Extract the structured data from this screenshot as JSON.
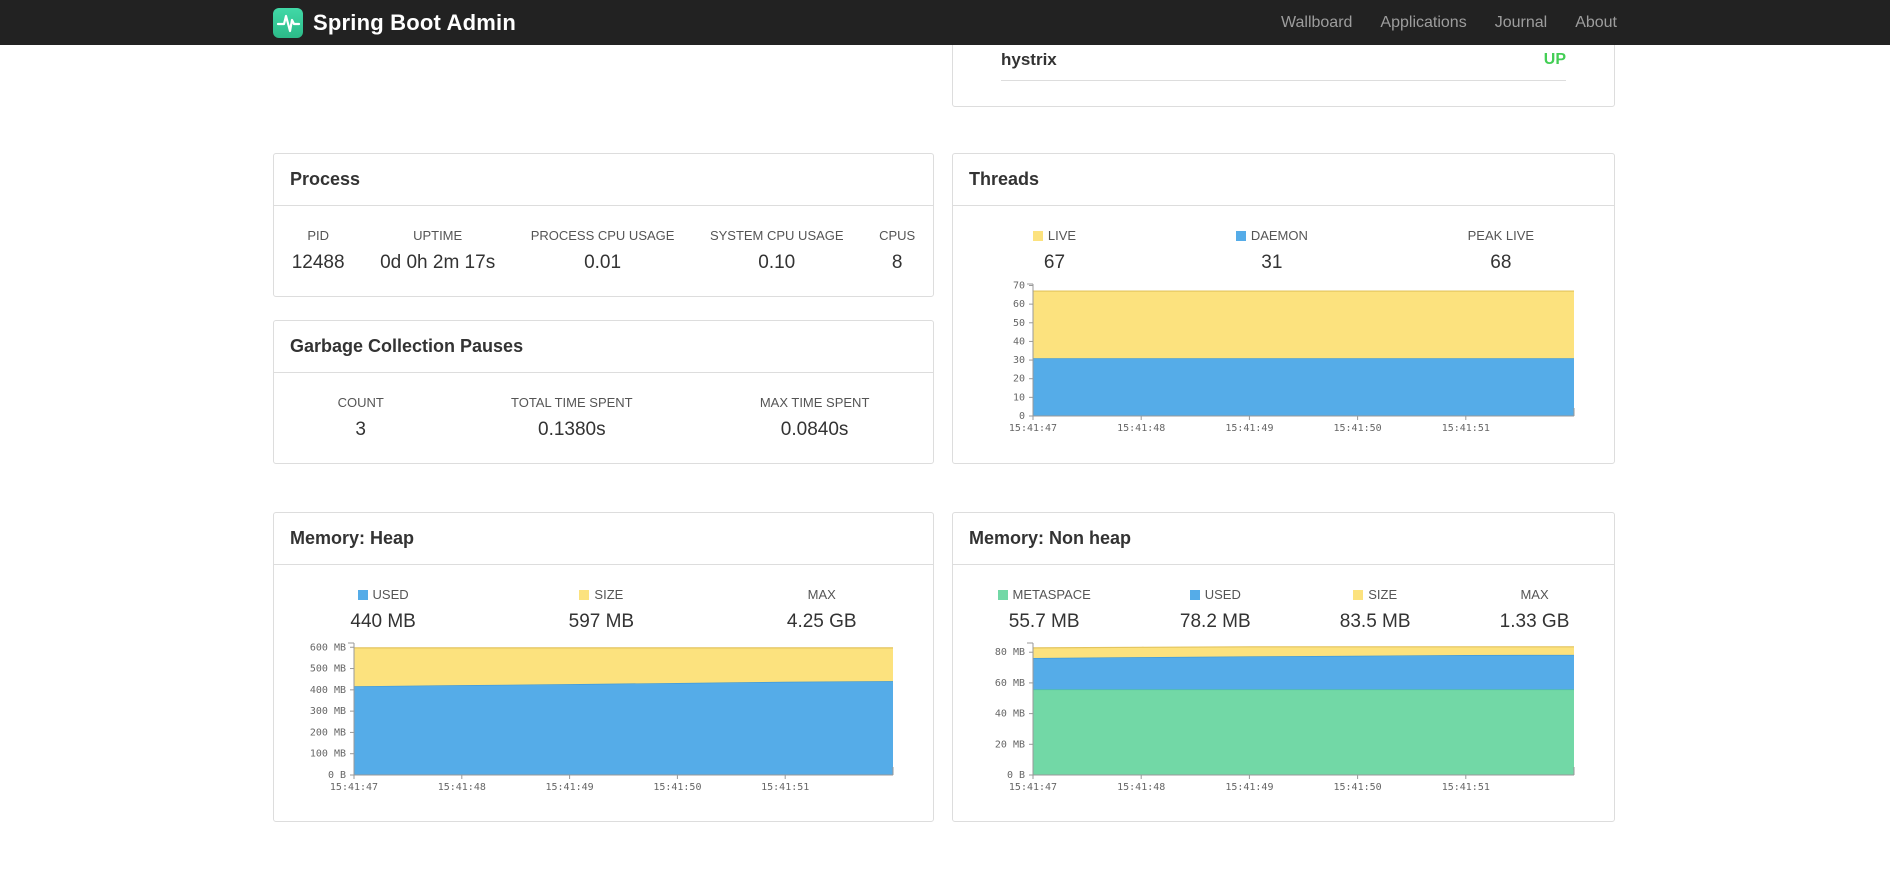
{
  "navbar": {
    "brand": "Spring Boot Admin",
    "links": [
      {
        "label": "Wallboard"
      },
      {
        "label": "Applications"
      },
      {
        "label": "Journal"
      },
      {
        "label": "About"
      }
    ],
    "brand_color": "#35CF9E"
  },
  "health_panel": {
    "item": "hystrix",
    "status": "UP",
    "status_color": "#43CE55"
  },
  "process": {
    "title": "Process",
    "stats": [
      {
        "label": "PID",
        "value": "12488"
      },
      {
        "label": "UPTIME",
        "value": "0d 0h 2m 17s"
      },
      {
        "label": "PROCESS CPU USAGE",
        "value": "0.01"
      },
      {
        "label": "SYSTEM CPU USAGE",
        "value": "0.10"
      },
      {
        "label": "CPUS",
        "value": "8"
      }
    ]
  },
  "gc": {
    "title": "Garbage Collection Pauses",
    "stats": [
      {
        "label": "COUNT",
        "value": "3"
      },
      {
        "label": "TOTAL TIME SPENT",
        "value": "0.1380s"
      },
      {
        "label": "MAX TIME SPENT",
        "value": "0.0840s"
      }
    ]
  },
  "threads": {
    "title": "Threads",
    "legend": [
      {
        "label": "LIVE",
        "value": "67",
        "color": "#FCE27E"
      },
      {
        "label": "DAEMON",
        "value": "31",
        "color": "#55ACE8"
      },
      {
        "label": "PEAK LIVE",
        "value": "68"
      }
    ]
  },
  "heap": {
    "title": "Memory: Heap",
    "legend": [
      {
        "label": "USED",
        "value": "440 MB",
        "color": "#55ACE8"
      },
      {
        "label": "SIZE",
        "value": "597 MB",
        "color": "#FCE27E"
      },
      {
        "label": "MAX",
        "value": "4.25 GB"
      }
    ]
  },
  "nonheap": {
    "title": "Memory: Non heap",
    "legend": [
      {
        "label": "METASPACE",
        "value": "55.7 MB",
        "color": "#72D8A6"
      },
      {
        "label": "USED",
        "value": "78.2 MB",
        "color": "#55ACE8"
      },
      {
        "label": "SIZE",
        "value": "83.5 MB",
        "color": "#FCE27E"
      },
      {
        "label": "MAX",
        "value": "1.33 GB"
      }
    ]
  },
  "chart_data": [
    {
      "id": "threads",
      "type": "area",
      "title": "Threads",
      "x_ticks": [
        "15:41:47",
        "15:41:48",
        "15:41:49",
        "15:41:50",
        "15:41:51"
      ],
      "y_max": 70.8,
      "y_ticks": [
        {
          "v": 0,
          "label": "0"
        },
        {
          "v": 10,
          "label": "10"
        },
        {
          "v": 20,
          "label": "20"
        },
        {
          "v": 30,
          "label": "30"
        },
        {
          "v": 40,
          "label": "40"
        },
        {
          "v": 50,
          "label": "50"
        },
        {
          "v": 60,
          "label": "60"
        },
        {
          "v": 70,
          "label": "70"
        }
      ],
      "series": [
        {
          "name": "DAEMON",
          "color": "#55ACE8",
          "line": "#3D96D4",
          "values": [
            31,
            31,
            31,
            31,
            31,
            31
          ]
        },
        {
          "name": "LIVE",
          "color": "#FCE27E",
          "line": "#E3C45C",
          "values": [
            67,
            67,
            67,
            67,
            67,
            67
          ]
        }
      ]
    },
    {
      "id": "heap",
      "type": "area",
      "title": "Memory: Heap",
      "x_ticks": [
        "15:41:47",
        "15:41:48",
        "15:41:49",
        "15:41:50",
        "15:41:51"
      ],
      "y_max": 620,
      "y_ticks": [
        {
          "v": 0,
          "label": "0 B"
        },
        {
          "v": 100,
          "label": "100 MB"
        },
        {
          "v": 200,
          "label": "200 MB"
        },
        {
          "v": 300,
          "label": "300 MB"
        },
        {
          "v": 400,
          "label": "400 MB"
        },
        {
          "v": 500,
          "label": "500 MB"
        },
        {
          "v": 600,
          "label": "600 MB"
        }
      ],
      "series": [
        {
          "name": "USED",
          "color": "#55ACE8",
          "line": "#3D96D4",
          "values": [
            417,
            422,
            427,
            432,
            438,
            441
          ]
        },
        {
          "name": "SIZE",
          "color": "#FCE27E",
          "line": "#E3C45C",
          "values": [
            597,
            597,
            597,
            597,
            597,
            597
          ]
        }
      ]
    },
    {
      "id": "nonheap",
      "type": "area",
      "title": "Memory: Non heap",
      "x_ticks": [
        "15:41:47",
        "15:41:48",
        "15:41:49",
        "15:41:50",
        "15:41:51"
      ],
      "y_max": 86,
      "y_ticks": [
        {
          "v": 0,
          "label": "0 B"
        },
        {
          "v": 20,
          "label": "20 MB"
        },
        {
          "v": 40,
          "label": "40 MB"
        },
        {
          "v": 60,
          "label": "60 MB"
        },
        {
          "v": 80,
          "label": "80 MB"
        }
      ],
      "series": [
        {
          "name": "METASPACE",
          "color": "#72D8A6",
          "line": "#50C68E",
          "values": [
            55.7,
            55.7,
            55.7,
            55.7,
            55.7,
            55.7
          ]
        },
        {
          "name": "USED",
          "color": "#55ACE8",
          "line": "#3D96D4",
          "values": [
            76.2,
            76.8,
            77.3,
            77.7,
            78.2,
            78.3
          ]
        },
        {
          "name": "SIZE",
          "color": "#FCE27E",
          "line": "#E3C45C",
          "values": [
            82.8,
            83.2,
            83.5,
            83.5,
            83.5,
            83.5
          ]
        }
      ]
    }
  ]
}
